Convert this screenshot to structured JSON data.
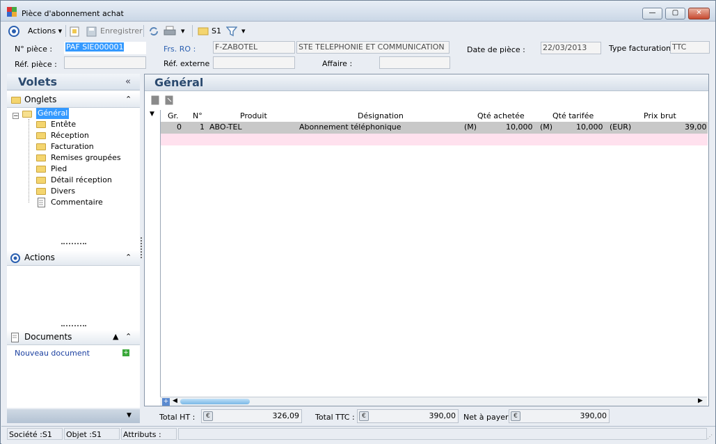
{
  "window": {
    "title": "Pièce d'abonnement achat",
    "minimize": "—",
    "maximize": "▢",
    "close": "✕"
  },
  "toolbar": {
    "actions_label": "Actions",
    "save_label": "Enregistrer",
    "s1_label": "S1"
  },
  "form": {
    "num_piece_label": "N° pièce :",
    "num_piece_value": "PAF SIE000001",
    "frs_label": "Frs. RO :",
    "frs_code": "F-ZABOTEL",
    "frs_name": "STE TELEPHONIE ET COMMUNICATION",
    "date_label": "Date de pièce :",
    "date_value": "22/03/2013",
    "type_fact_label": "Type facturation :",
    "type_fact_value": "TTC",
    "ref_piece_label": "Réf. pièce :",
    "ref_piece_value": "",
    "ref_externe_label": "Réf. externe :",
    "ref_externe_value": "",
    "affaire_label": "Affaire :",
    "affaire_value": ""
  },
  "left": {
    "volets_title": "Volets",
    "onglets_title": "Onglets",
    "tree": [
      "Général",
      "Entête",
      "Réception",
      "Facturation",
      "Remises groupées",
      "Pied",
      "Détail réception",
      "Divers",
      "Commentaire"
    ],
    "actions_title": "Actions",
    "documents_title": "Documents",
    "new_doc_label": "Nouveau document"
  },
  "main": {
    "title": "Général",
    "columns": [
      "Gr.",
      "N°",
      "Produit",
      "Désignation",
      "Qté achetée",
      "Qté tarifée",
      "Prix brut"
    ],
    "rows": [
      {
        "gr": "0",
        "num": "1",
        "produit": "ABO-TEL",
        "designation": "Abonnement téléphonique",
        "unit1": "(M)",
        "qte_achetee": "10,000",
        "unit2": "(M)",
        "qte_tarifee": "10,000",
        "devise": "(EUR)",
        "prix_brut": "39,00"
      }
    ]
  },
  "totals": {
    "ht_label": "Total HT :",
    "ht_value": "326,09",
    "ttc_label": "Total TTC :",
    "ttc_value": "390,00",
    "net_label": "Net à payer :",
    "net_value": "390,00",
    "currency_symbol": "€"
  },
  "status": {
    "societe": "Société :S1",
    "objet": "Objet :S1",
    "attributs": "Attributs :"
  },
  "colors": {
    "selection": "#3399ff",
    "row_selected": "#c8c8c8",
    "row_new": "#ffe1ee",
    "panel_title": "#2b4a6f"
  }
}
